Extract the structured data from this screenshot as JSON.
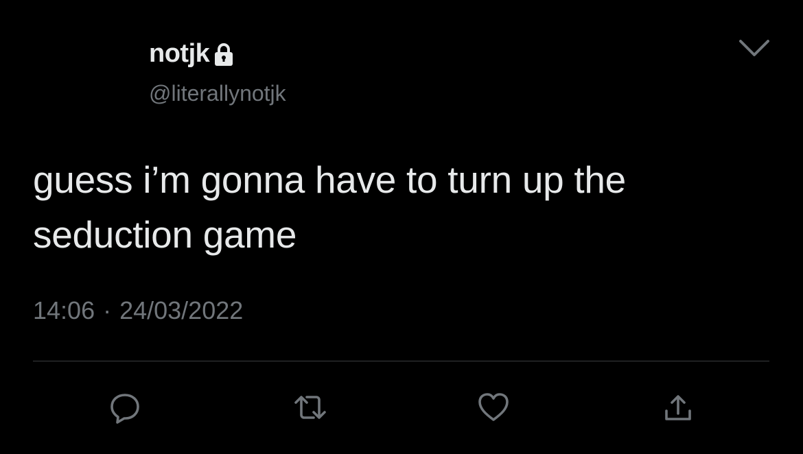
{
  "author": {
    "display_name": "notjk",
    "handle": "@literallynotjk",
    "protected_icon": "lock-icon"
  },
  "tweet": {
    "text": "guess i’m gonna have to turn up the seduction game",
    "time": "14:06",
    "separator": "·",
    "date": "24/03/2022"
  },
  "actions": [
    {
      "name": "reply",
      "icon": "reply-icon"
    },
    {
      "name": "retweet",
      "icon": "retweet-icon"
    },
    {
      "name": "like",
      "icon": "heart-icon"
    },
    {
      "name": "share",
      "icon": "share-icon"
    }
  ],
  "menu": {
    "icon": "chevron-down-icon"
  },
  "colors": {
    "background": "#000000",
    "primary_text": "#e7e9ea",
    "secondary_text": "#71767b",
    "divider": "#3a3d40"
  }
}
